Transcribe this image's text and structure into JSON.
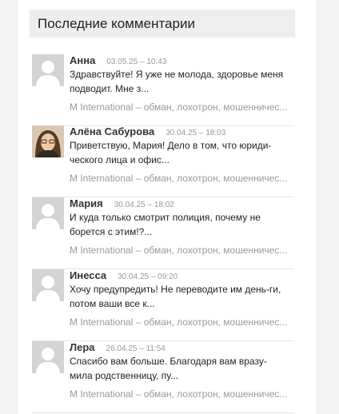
{
  "widget": {
    "title": "Последние комментарии"
  },
  "comments": [
    {
      "author": "Анна",
      "date": "03.05.25 – 10:43",
      "text": "Здравствуйте! Я уже не молода, здоровье меня подводит. Мне з...",
      "link": "M International – обман, лохотрон, мошенничес...",
      "avatar": "default-avatar"
    },
    {
      "author": "Алёна Сабурова",
      "date": "30.04.25 – 18:03",
      "text": "Приветствую, Мария! Дело в том, что юриди-ческого лица и офис...",
      "link": "M International – обман, лохотрон, мошенничес...",
      "avatar": "photo-avatar"
    },
    {
      "author": "Мария",
      "date": "30.04.25 – 18:02",
      "text": "И куда только смотрит полиция, почему не борется с этим!?...",
      "link": "M International – обман, лохотрон, мошенничес...",
      "avatar": "default-avatar"
    },
    {
      "author": "Инесса",
      "date": "30.04.25 – 09:20",
      "text": "Хочу предупредить! Не переводите им день-ги, потом ваши все к...",
      "link": "M International – обман, лохотрон, мошенничес...",
      "avatar": "default-avatar"
    },
    {
      "author": "Лера",
      "date": "26.04.25 – 11:54",
      "text": "Спасибо вам больше. Благодаря вам вразу-мила родственницу, пу...",
      "link": "M International – обман, лохотрон, мошенничес...",
      "avatar": "default-avatar"
    }
  ]
}
